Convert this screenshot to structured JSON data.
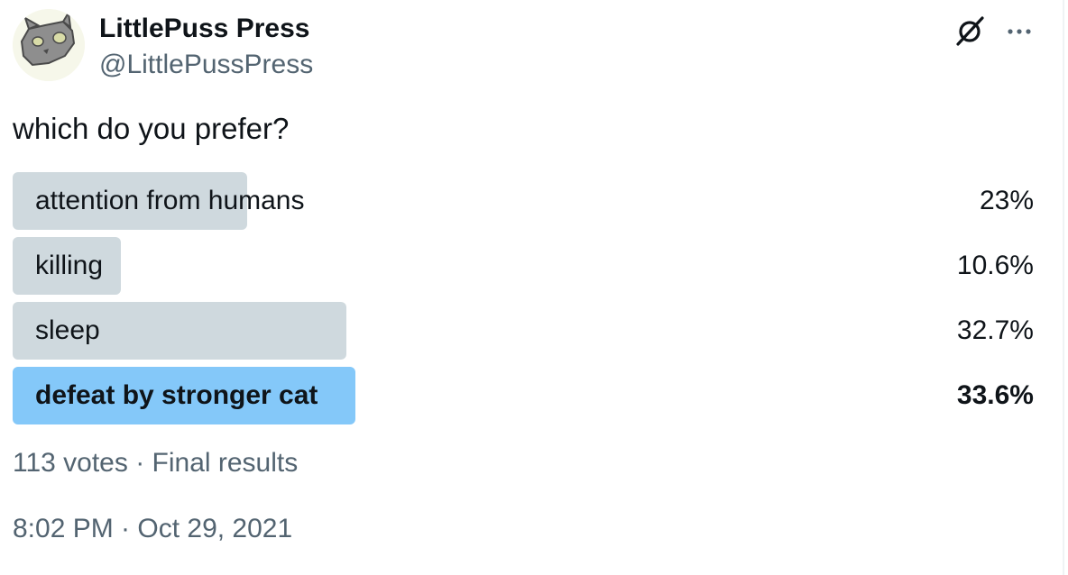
{
  "author": {
    "display_name": "LittlePuss Press",
    "handle": "@LittlePussPress",
    "avatar_icon": "cat-avatar-icon"
  },
  "header_icons": {
    "grok": "grok-icon",
    "more": "more-icon"
  },
  "tweet": {
    "text": "which do you prefer?"
  },
  "poll": {
    "options": [
      {
        "label": "attention from humans",
        "percent_text": "23%",
        "percent": 23.0,
        "winner": false
      },
      {
        "label": "killing",
        "percent_text": "10.6%",
        "percent": 10.6,
        "winner": false
      },
      {
        "label": "sleep",
        "percent_text": "32.7%",
        "percent": 32.7,
        "winner": false
      },
      {
        "label": "defeat by stronger cat",
        "percent_text": "33.6%",
        "percent": 33.6,
        "winner": true
      }
    ],
    "meta": "113 votes · Final results"
  },
  "timestamp": "8:02 PM · Oct 29, 2021",
  "colors": {
    "bar": "#cfd9de",
    "winner_bar": "#84c8f9",
    "secondary_text": "#536471",
    "primary_text": "#0f1419"
  }
}
